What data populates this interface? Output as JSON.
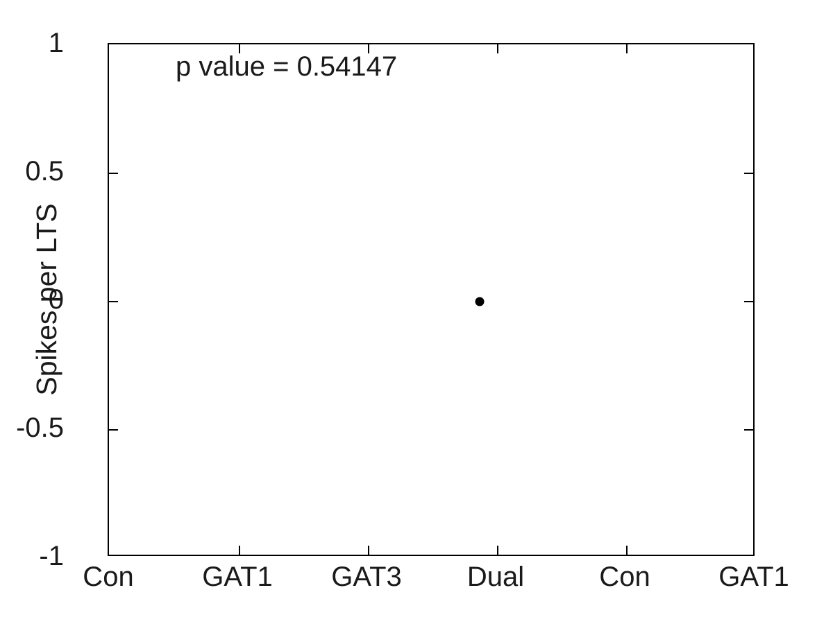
{
  "figure": {
    "background_color": "#ffffff",
    "axis_color": "#000000",
    "text_color": "#1a1a1a",
    "marker_color": "#000000"
  },
  "annotation": {
    "p_value_text": "p value = 0.54147"
  },
  "axes": {
    "y_title": "Spikes per LTS",
    "x_title": ""
  },
  "chart_data": {
    "type": "scatter",
    "title": "",
    "xlabel": "",
    "ylabel": "Spikes per LTS",
    "categories": [
      "Con",
      "GAT1",
      "GAT3",
      "Dual",
      "Con",
      "GAT1"
    ],
    "x_tick_labels": [
      "Con",
      "GAT1",
      "GAT3",
      "Dual",
      "Con",
      "GAT1"
    ],
    "y_tick_labels": [
      "1",
      "0.5",
      "0",
      "-0.5",
      "-1"
    ],
    "y_ticks": [
      1,
      0.5,
      0,
      -0.5,
      -1
    ],
    "ylim": [
      -1,
      1
    ],
    "xlim": [
      0.5,
      6.5
    ],
    "grid": false,
    "legend": null,
    "annotations": [
      {
        "text": "p value = 0.54147",
        "position": "top-left-inside",
        "value": 0.54147
      }
    ],
    "series": [
      {
        "name": "Spikes per LTS",
        "marker": "circle",
        "color": "#000000",
        "points": [
          {
            "category": "Dual",
            "x": 3.92,
            "y": 0
          }
        ]
      }
    ],
    "values": [
      null,
      null,
      null,
      0,
      null,
      null
    ]
  }
}
